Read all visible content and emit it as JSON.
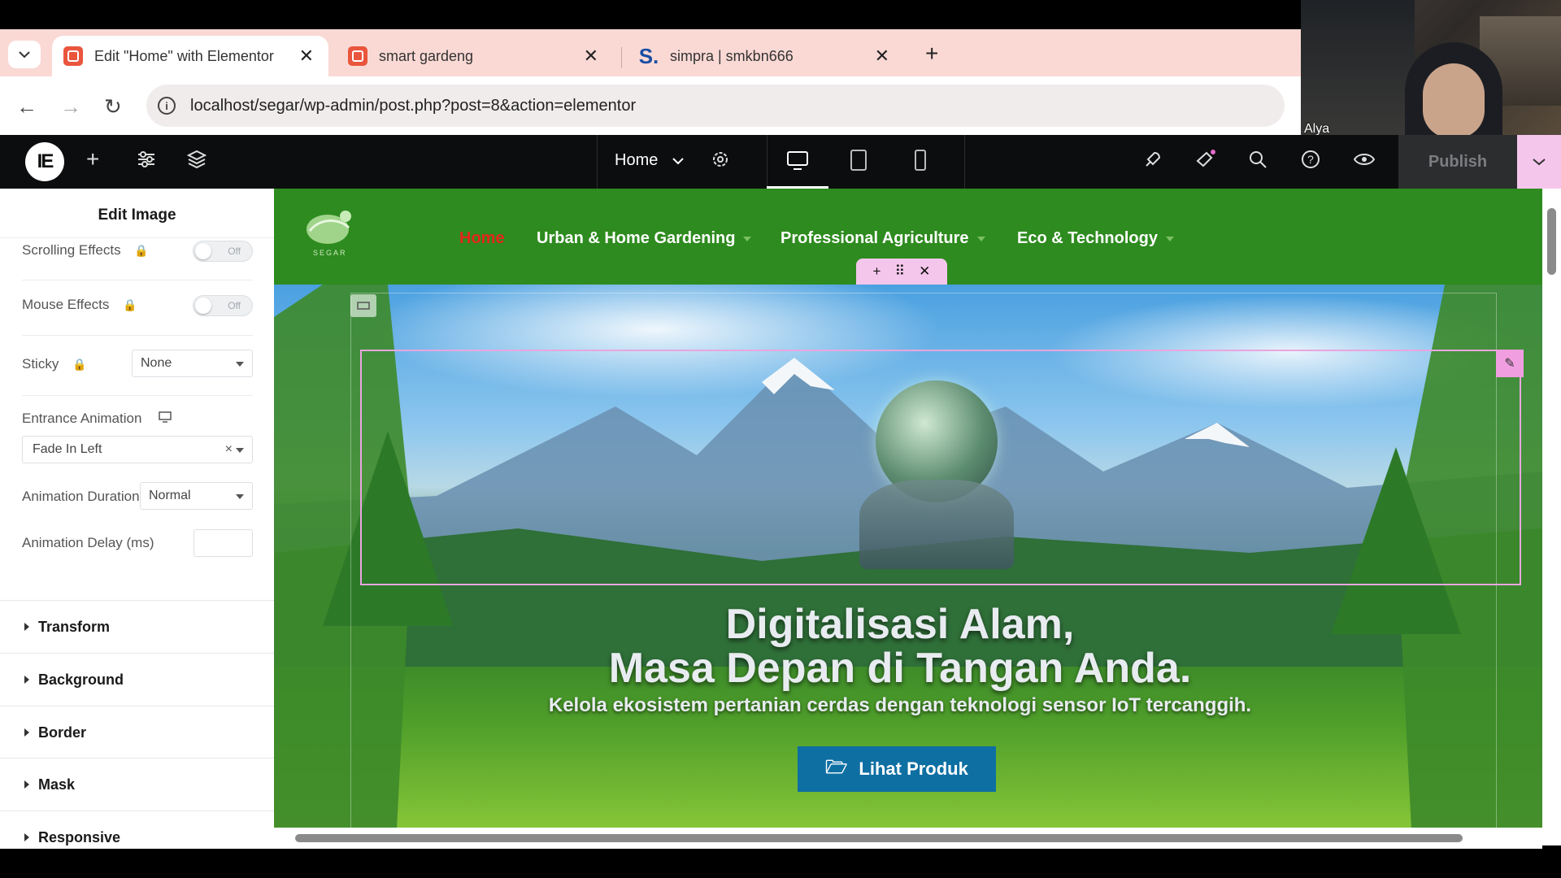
{
  "browser": {
    "tabs": [
      {
        "title": "Edit \"Home\" with Elementor",
        "icon": "elementor-tab-icon",
        "active": true
      },
      {
        "title": "smart gardeng",
        "icon": "elementor-tab-icon",
        "active": false
      },
      {
        "title": "simpra | smkbn666",
        "icon": "s-logo-icon",
        "active": false
      }
    ],
    "url": "localhost/segar/wp-admin/post.php?post=8&action=elementor"
  },
  "webcam": {
    "name": "Alya"
  },
  "elementor_bar": {
    "page": "Home",
    "publish_label": "Publish"
  },
  "panel": {
    "title": "Edit Image",
    "scrolling_effects_label": "Scrolling Effects",
    "scrolling_effects_value": "Off",
    "mouse_effects_label": "Mouse Effects",
    "mouse_effects_value": "Off",
    "sticky_label": "Sticky",
    "sticky_value": "None",
    "entrance_label": "Entrance Animation",
    "entrance_value": "Fade In Left",
    "entrance_clear": "×",
    "duration_label": "Animation Duration",
    "duration_value": "Normal",
    "delay_label": "Animation Delay (ms)",
    "sections": [
      "Transform",
      "Background",
      "Border",
      "Mask",
      "Responsive"
    ]
  },
  "site": {
    "nav": [
      "Home",
      "Urban & Home Gardening",
      "Professional Agriculture",
      "Eco & Technology"
    ],
    "logo_text": "SEGAR",
    "hero_title_line1": "Digitalisasi Alam,",
    "hero_title_line2": "Masa Depan di Tangan Anda.",
    "hero_subtitle": "Kelola ekosistem pertanian cerdas dengan teknologi sensor IoT tercanggih.",
    "cta_label": "Lihat Produk"
  },
  "colors": {
    "tabbar": "#fad9d5",
    "elementor_bar": "#0c0d0e",
    "site_green": "#2e8b1f",
    "nav_active": "#e4261c",
    "cta_blue": "#0e6fa3",
    "edit_outline": "#e8a6df"
  }
}
